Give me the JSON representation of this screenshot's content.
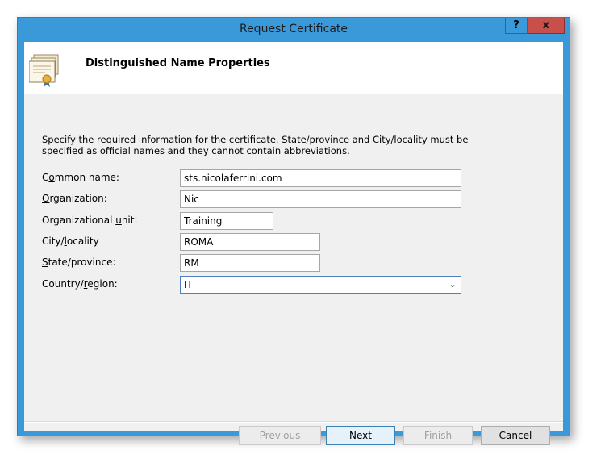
{
  "window": {
    "title": "Request Certificate",
    "help_label": "?",
    "close_label": "x"
  },
  "header": {
    "title": "Distinguished Name Properties",
    "icon": "certificate-icon"
  },
  "description": "Specify the required information for the certificate. State/province and City/locality must be specified as official names and they cannot contain abbreviations.",
  "form": {
    "common_name": {
      "label_pre": "C",
      "label_u": "o",
      "label_post": "mmon name:",
      "value": "sts.nicolaferrini.com"
    },
    "organization": {
      "label_pre": "",
      "label_u": "O",
      "label_post": "rganization:",
      "value": "Nic"
    },
    "org_unit": {
      "label_pre": "Organizational ",
      "label_u": "u",
      "label_post": "nit:",
      "value": "Training"
    },
    "city": {
      "label_pre": "City/",
      "label_u": "l",
      "label_post": "ocality",
      "value": "ROMA"
    },
    "state": {
      "label_pre": "",
      "label_u": "S",
      "label_post": "tate/province:",
      "value": "RM"
    },
    "country": {
      "label_pre": "Country/",
      "label_u": "r",
      "label_post": "egion:",
      "value": "IT"
    }
  },
  "buttons": {
    "previous": {
      "pre": "",
      "u": "P",
      "post": "revious"
    },
    "next": {
      "pre": "",
      "u": "N",
      "post": "ext"
    },
    "finish": {
      "pre": "",
      "u": "F",
      "post": "inish"
    },
    "cancel": "Cancel"
  },
  "colors": {
    "titlebar": "#3a9ad9",
    "close": "#c7504b",
    "client": "#f0f0f0"
  }
}
